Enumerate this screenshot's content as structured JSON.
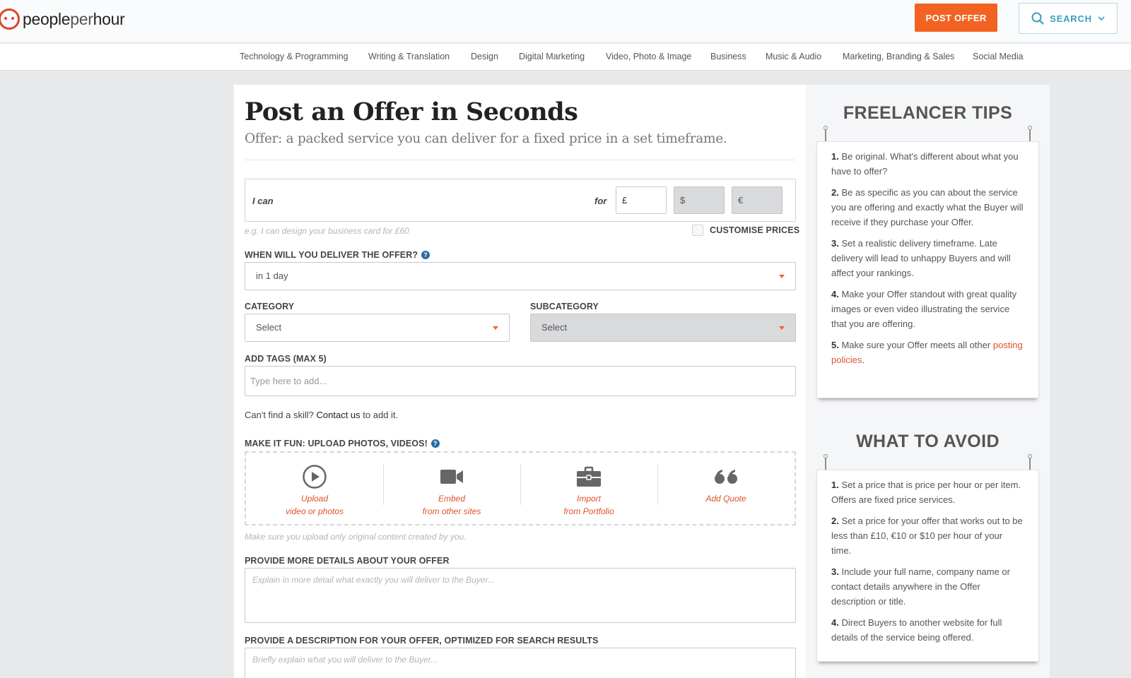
{
  "header": {
    "logo_text_a": "people",
    "logo_text_b": "per",
    "logo_text_c": "hour",
    "post_offer_label": "POST OFFER",
    "search_label": "SEARCH",
    "accent_color": "#f26322",
    "search_color": "#3a9fbf"
  },
  "category_nav": [
    "Technology & Programming",
    "Writing & Translation",
    "Design",
    "Digital Marketing",
    "Video, Photo & Image",
    "Business",
    "Music & Audio",
    "Marketing, Branding & Sales",
    "Social Media"
  ],
  "form": {
    "title": "Post an Offer in Seconds",
    "subtitle": "Offer: a packed service you can deliver for a fixed price in a set timeframe.",
    "ican_label": "I can",
    "for_label": "for",
    "currency_gbp": "£",
    "currency_usd": "$",
    "currency_eur": "€",
    "ican_hint": "e.g. I can design your business card for £60",
    "customise_prices_label": "CUSTOMISE PRICES",
    "delivery_label": "WHEN WILL YOU DELIVER THE OFFER?",
    "delivery_value": "in 1 day",
    "category_label": "CATEGORY",
    "category_value": "Select",
    "subcategory_label": "SUBCATEGORY",
    "subcategory_value": "Select",
    "tags_label": "ADD TAGS (MAX 5)",
    "tags_placeholder": "Type here to add...",
    "skill_text_a": "Can't find a skill?",
    "skill_link": "Contact us",
    "skill_text_b": "to add it.",
    "upload_label": "MAKE IT FUN: UPLOAD PHOTOS, VIDEOS!",
    "upload_options": [
      {
        "line1": "Upload",
        "line2": "video or photos",
        "icon": "play-circle-icon"
      },
      {
        "line1": "Embed",
        "line2": "from other sites",
        "icon": "video-camera-icon"
      },
      {
        "line1": "Import",
        "line2": "from Portfolio",
        "icon": "briefcase-icon"
      },
      {
        "line1": "Add Quote",
        "line2": "",
        "icon": "quote-icon"
      }
    ],
    "upload_hint": "Make sure you upload only original content created by you.",
    "details_label": "PROVIDE MORE DETAILS ABOUT YOUR OFFER",
    "details_placeholder": "Explain in more detail what exactly you will deliver to the Buyer...",
    "description_label": "PROVIDE A DESCRIPTION FOR YOUR OFFER, OPTIMIZED FOR SEARCH RESULTS",
    "description_placeholder": "Briefly explain what you will deliver to the Buyer..."
  },
  "sidebar": {
    "tips_title": "FREELANCER TIPS",
    "tips": [
      {
        "num": "1.",
        "text": "Be original. What's different about what you have to offer?"
      },
      {
        "num": "2.",
        "text": "Be as specific as you can about the service you are offering and exactly what the Buyer will receive if they purchase your Offer."
      },
      {
        "num": "3.",
        "text": "Set a realistic delivery timeframe. Late delivery will lead to unhappy Buyers and will affect your rankings."
      },
      {
        "num": "4.",
        "text": "Make your Offer standout with great quality images or even video illustrating the service that you are offering."
      },
      {
        "num": "5.",
        "text": "Make sure your Offer meets all other",
        "link": "posting policies",
        "tail": "."
      }
    ],
    "avoid_title": "WHAT TO AVOID",
    "avoid": [
      {
        "num": "1.",
        "text": "Set a price that is price per hour or per item. Offers are fixed price services."
      },
      {
        "num": "2.",
        "text": "Set a price for your offer that works out to be less than £10, €10 or $10 per hour of your time."
      },
      {
        "num": "3.",
        "text": "Include your full name, company name or contact details anywhere in the Offer description or title."
      },
      {
        "num": "4.",
        "text": "Direct Buyers to another website for full details of the service being offered."
      }
    ]
  }
}
